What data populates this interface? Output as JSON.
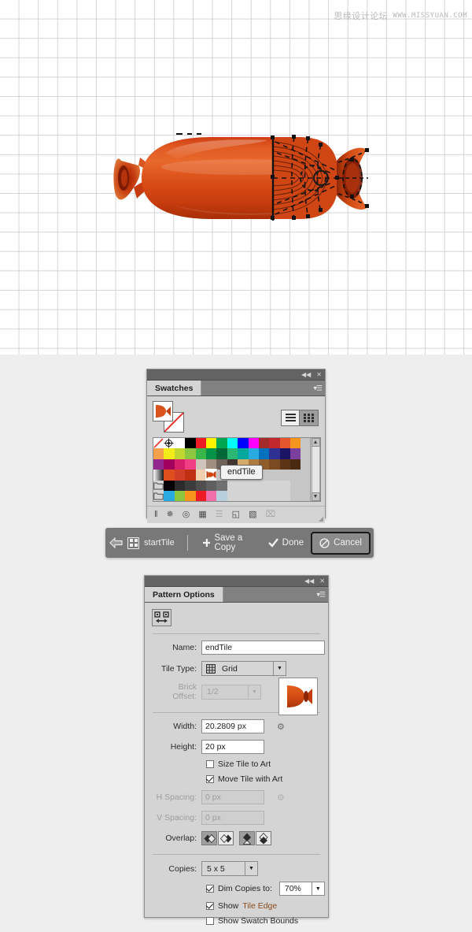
{
  "watermark": {
    "cn": "思缘设计论坛",
    "en": "WWW.MISSYUAN.COM"
  },
  "canvas": {
    "name": "artboard-grid",
    "artwork_label": "sausage-pattern-art"
  },
  "swatches_panel": {
    "title": "Swatches",
    "topbar": {
      "collapse_icon": "◀◀",
      "close_icon": "✕"
    },
    "menu_icon": "panel-menu-icon",
    "fill_label": "Fill",
    "stroke_label": "Stroke (None)",
    "view_list_icon": "list-view-icon",
    "view_grid_icon": "grid-view-icon",
    "tooltip": "endTile",
    "scroll_up": "▲",
    "scroll_down": "▼",
    "footer_icons": [
      {
        "name": "swatch-libraries-menu-icon",
        "glyph": "‖",
        "dim": false
      },
      {
        "name": "show-swatch-kinds-icon",
        "glyph": "✵",
        "dim": false
      },
      {
        "name": "color-group-icon",
        "glyph": "◎",
        "dim": false
      },
      {
        "name": "swatch-options-grid-icon",
        "glyph": "▦",
        "dim": false
      },
      {
        "name": "swatch-options-icon",
        "glyph": "☰",
        "dim": true
      },
      {
        "name": "new-color-group-icon",
        "glyph": "◱",
        "dim": false
      },
      {
        "name": "new-swatch-icon",
        "glyph": "▧",
        "dim": false
      },
      {
        "name": "delete-swatch-icon",
        "glyph": "⌧",
        "dim": true
      }
    ],
    "rows": [
      [
        "none",
        "registration",
        "#ffffff",
        "#000000",
        "#ed1c24",
        "#fff200",
        "#00a651",
        "#00fff6",
        "#0000ff",
        "#ff00ff",
        "#a52a2a",
        "#c1272d",
        "#e4572e",
        "#f7941e"
      ],
      [
        "#f5a04a",
        "#f3ec18",
        "#bfd730",
        "#8dc63f",
        "#39b54a",
        "#009245",
        "#006837",
        "#2bb673",
        "#00a79d",
        "#29abe2",
        "#0071bc",
        "#2e3192",
        "#1b1464",
        "#7b3fa0"
      ],
      [
        "#92278f",
        "#a1005e",
        "#d6206c",
        "#ef3e84",
        "#cfc3bb",
        "#a08e80",
        "#6e6259",
        "#41362f",
        "#d4ab6a",
        "#b07b3e",
        "#8f5c2c",
        "#7a4a22",
        "#5c3517",
        "#4a2a11"
      ],
      [
        "#f0f0f0-grad",
        "#e04e20",
        "#d03e2a",
        "#bf2f12",
        "#f2cfae",
        "pattern-endtile",
        "",
        "",
        "",
        "",
        "",
        "",
        "",
        ""
      ],
      [
        "group",
        "#000000",
        "#2b2b2b",
        "#3c3c3c",
        "#4e4e4e",
        "#5f5f5f",
        "#717171",
        "",
        "",
        "",
        "",
        "",
        ""
      ],
      [
        "group",
        "#29abe2",
        "#8dc63f",
        "#f7941e",
        "#ed1c24",
        "#f06eaa",
        "#b8cfe0",
        "",
        "",
        "",
        "",
        "",
        ""
      ]
    ]
  },
  "pattern_bar": {
    "back_icon": "back-arrow-icon",
    "tile_icon": "pattern-tile-icon",
    "pattern_name": "startTile",
    "save_copy": {
      "label": "Save a Copy",
      "icon": "plus-icon"
    },
    "done": {
      "label": "Done",
      "icon": "check-icon"
    },
    "cancel": {
      "label": "Cancel",
      "icon": "no-entry-icon"
    }
  },
  "pattern_options": {
    "title": "Pattern Options",
    "topbar": {
      "collapse_icon": "◀◀",
      "close_icon": "✕"
    },
    "tile_tool_icon": "pattern-tile-tool-icon",
    "name": {
      "label": "Name:",
      "value": "endTile"
    },
    "tile_type": {
      "label": "Tile Type:",
      "value": "Grid",
      "icon": "grid-icon",
      "arrow": "▼"
    },
    "brick_offset": {
      "label": "Brick Offset:",
      "value": "1/2",
      "arrow": "▼",
      "disabled": true
    },
    "preview_label": "pattern-tile-preview",
    "width": {
      "label": "Width:",
      "value": "20.2809 px"
    },
    "height": {
      "label": "Height:",
      "value": "20 px"
    },
    "size_tile_to_art": {
      "label": "Size Tile to Art",
      "checked": false
    },
    "move_tile_with_art": {
      "label": "Move Tile with Art",
      "checked": true
    },
    "h_spacing": {
      "label": "H Spacing:",
      "value": "0 px",
      "disabled": true
    },
    "v_spacing": {
      "label": "V Spacing:",
      "value": "0 px",
      "disabled": true
    },
    "overlap": {
      "label": "Overlap:",
      "buttons": [
        {
          "name": "overlap-left-in-front",
          "selected": true
        },
        {
          "name": "overlap-right-in-front",
          "selected": false
        },
        {
          "name": "overlap-top-in-front",
          "selected": true
        },
        {
          "name": "overlap-bottom-in-front",
          "selected": false
        }
      ]
    },
    "copies": {
      "label": "Copies:",
      "value": "5 x 5",
      "arrow": "▼"
    },
    "dim_copies": {
      "label": "Dim Copies to:",
      "checked": true,
      "value": "70%",
      "arrow": "▼"
    },
    "show_tile_edge": {
      "label_a": "Show ",
      "label_b": "Tile Edge",
      "checked": true
    },
    "show_swatch_bounds": {
      "label": "Show Swatch Bounds",
      "checked": false
    }
  }
}
